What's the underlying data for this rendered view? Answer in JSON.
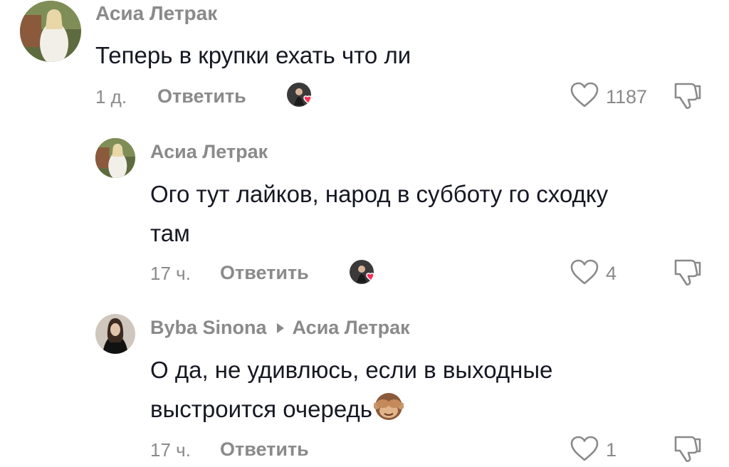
{
  "comments": [
    {
      "author": "Асиа Летрак",
      "text": "Теперь в крупки ехать что ли",
      "time": "1 д.",
      "reply_label": "Ответить",
      "likes": "1187",
      "avatar": "avatar-photo-woman-white-dress"
    },
    {
      "author": "Асиа Летрак",
      "text_line1": "Ого тут лайков, народ в субботу го сходку",
      "text_line2": "там",
      "time": "17 ч.",
      "reply_label": "Ответить",
      "likes": "4",
      "avatar": "avatar-photo-woman-white-dress"
    },
    {
      "author": "Byba Sinona",
      "reply_to": "Асиа Летрак",
      "text_line1": "О да, не удивлюсь, если в выходные",
      "text_line2": "выстроится очередь",
      "text_emoji": "see-no-evil-monkey",
      "time": "17 ч.",
      "reply_label": "Ответить",
      "likes": "1",
      "avatar": "avatar-photo-woman-dark"
    }
  ],
  "icons": {
    "like": "heart-outline-icon",
    "dislike": "thumbs-down-icon",
    "creator_liked": "creator-liked-badge"
  },
  "colors": {
    "text": "#161823",
    "secondary": "#8a8a8a",
    "heart_badge": "#fe2c55"
  }
}
